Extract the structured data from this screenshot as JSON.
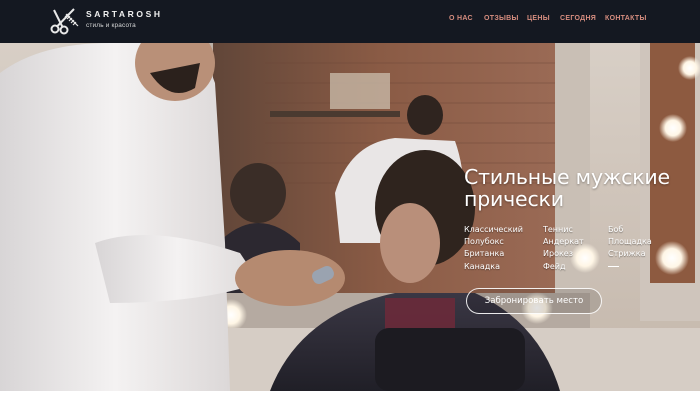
{
  "header": {
    "brand": "SARTAROSH",
    "tagline": "стиль и красота",
    "logo_icon": "scissors-comb-icon",
    "nav": [
      {
        "label": "О НАС"
      },
      {
        "label": "ОТЗЫВЫ"
      },
      {
        "label": "ЦЕНЫ"
      },
      {
        "label": "СЕГОДНЯ"
      },
      {
        "label": "КОНТАКТЫ"
      }
    ],
    "nav_color": "#d68d7f",
    "background": "#141821"
  },
  "hero": {
    "title": "Стильные мужские прически",
    "styles_col1": [
      "Классический",
      "Полубокс",
      "Британка",
      "Канадка"
    ],
    "styles_col2": [
      "Теннис",
      "Андеркат",
      "Ирокез",
      "Фейд"
    ],
    "styles_col3": [
      "Боб",
      "Площадка",
      "Стрижка"
    ],
    "book_button": "Забронировать место"
  }
}
